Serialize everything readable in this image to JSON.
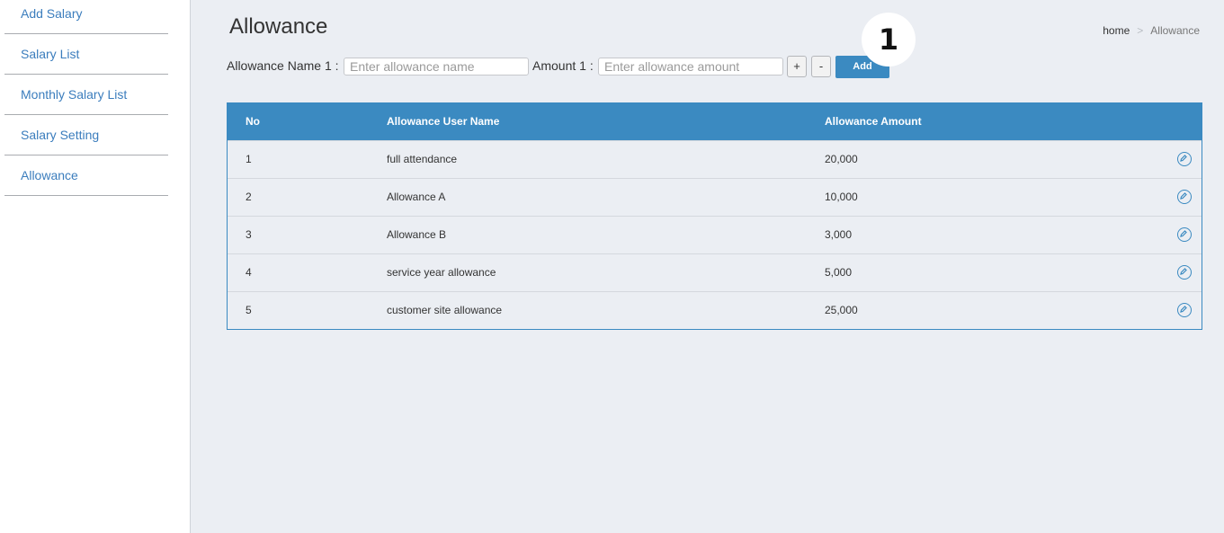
{
  "sidebar": {
    "items": [
      {
        "label": "Add Salary"
      },
      {
        "label": "Salary List"
      },
      {
        "label": "Monthly Salary List"
      },
      {
        "label": "Salary Setting"
      },
      {
        "label": "Allowance"
      }
    ]
  },
  "header": {
    "title": "Allowance",
    "breadcrumb": {
      "home": "home",
      "separator": ">",
      "current": "Allowance"
    }
  },
  "form": {
    "name_label": "Allowance Name 1 :",
    "name_placeholder": "Enter allowance name",
    "amount_label": "Amount 1 :",
    "amount_placeholder": "Enter allowance amount",
    "plus_label": "+",
    "minus_label": "-",
    "add_label": "Add"
  },
  "annotation": {
    "marker": "1"
  },
  "table": {
    "headers": [
      "No",
      "Allowance User Name",
      "Allowance Amount"
    ],
    "rows": [
      {
        "no": "1",
        "name": "full attendance",
        "amount": "20,000"
      },
      {
        "no": "2",
        "name": "Allowance A",
        "amount": "10,000"
      },
      {
        "no": "3",
        "name": "Allowance B",
        "amount": "3,000"
      },
      {
        "no": "4",
        "name": "service year allowance",
        "amount": "5,000"
      },
      {
        "no": "5",
        "name": "customer site allowance",
        "amount": "25,000"
      }
    ]
  },
  "icons": {
    "edit": "pencil-edit-icon"
  },
  "colors": {
    "accent": "#3b8ac1",
    "link": "#3b7dbd",
    "background": "#ebeef3"
  }
}
